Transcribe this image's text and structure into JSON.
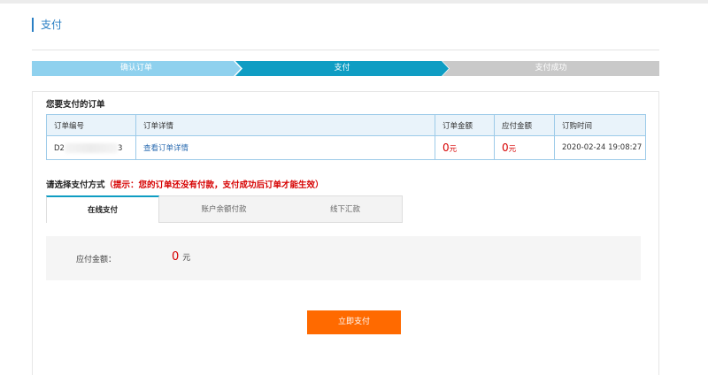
{
  "page": {
    "title": "支付"
  },
  "steps": [
    {
      "label": "确认订单",
      "state": "done"
    },
    {
      "label": "支付",
      "state": "current"
    },
    {
      "label": "支付成功",
      "state": "todo"
    }
  ],
  "orders": {
    "heading": "您要支付的订单",
    "columns": [
      "订单编号",
      "订单详情",
      "订单金额",
      "应付金额",
      "订购时间"
    ],
    "rows": [
      {
        "order_no_prefix": "D2",
        "order_no_suffix": "3",
        "detail_link": "查看订单详情",
        "order_amount": "0",
        "order_amount_unit": "元",
        "payable_amount": "0",
        "payable_amount_unit": "元",
        "order_time": "2020-02-24 19:08:27"
      }
    ]
  },
  "payment": {
    "method_label": "请选择支付方式",
    "hint": "（提示：您的订单还没有付款，支付成功后订单才能生效）",
    "tabs": [
      "在线支付",
      "账户余额付款",
      "线下汇款"
    ],
    "active_tab": 0,
    "amount_label": "应付金额：",
    "amount_value": "0",
    "amount_unit": "元",
    "pay_button": "立即支付"
  },
  "colors": {
    "accent": "#0f9dc3",
    "step_done": "#8fd1ee",
    "step_todo": "#c9c9c9",
    "amount_red": "#d60000",
    "pay_button": "#ff6a00",
    "title_blue": "#2a7fc4"
  }
}
